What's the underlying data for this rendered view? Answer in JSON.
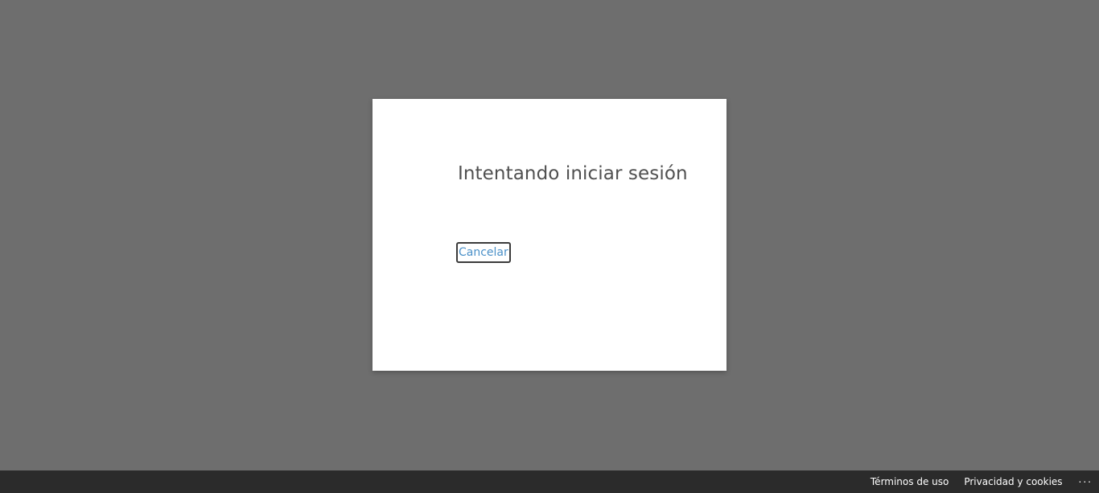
{
  "dialog": {
    "title": "Intentando iniciar sesión",
    "cancel_label": "Cancelar"
  },
  "footer": {
    "links": [
      {
        "label": "Términos de uso"
      },
      {
        "label": "Privacidad y cookies"
      }
    ],
    "more_label": "..."
  },
  "colors": {
    "backdrop": "#6e6e6e",
    "dialog_background": "#ffffff",
    "title_text": "#505050",
    "link": "#4a90c8",
    "footer_background": "#2b2b2b",
    "footer_text": "#ffffff"
  },
  "icons": {
    "more": "ellipsis-icon"
  }
}
